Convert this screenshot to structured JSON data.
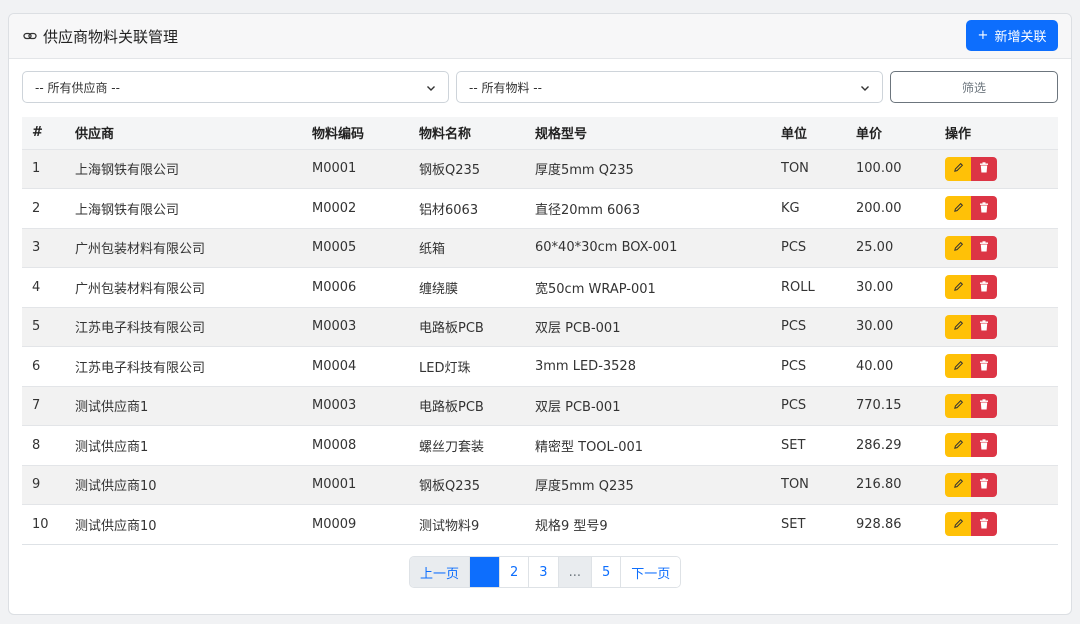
{
  "header": {
    "title": "供应商物料关联管理",
    "add_label": "新增关联"
  },
  "filters": {
    "supplier": "-- 所有供应商 --",
    "material": "-- 所有物料 --",
    "filter_label": "筛选"
  },
  "table": {
    "columns": [
      "#",
      "供应商",
      "物料编码",
      "物料名称",
      "规格型号",
      "单位",
      "单价",
      "操作"
    ],
    "rows": [
      [
        "1",
        "上海钢铁有限公司",
        "M0001",
        "钢板Q235",
        "厚度5mm Q235",
        "TON",
        "100.00"
      ],
      [
        "2",
        "上海钢铁有限公司",
        "M0002",
        "铝材6063",
        "直径20mm 6063",
        "KG",
        "200.00"
      ],
      [
        "3",
        "广州包装材料有限公司",
        "M0005",
        "纸箱",
        "60*40*30cm BOX-001",
        "PCS",
        "25.00"
      ],
      [
        "4",
        "广州包装材料有限公司",
        "M0006",
        "缠绕膜",
        "宽50cm WRAP-001",
        "ROLL",
        "30.00"
      ],
      [
        "5",
        "江苏电子科技有限公司",
        "M0003",
        "电路板PCB",
        "双层 PCB-001",
        "PCS",
        "30.00"
      ],
      [
        "6",
        "江苏电子科技有限公司",
        "M0004",
        "LED灯珠",
        "3mm LED-3528",
        "PCS",
        "40.00"
      ],
      [
        "7",
        "测试供应商1",
        "M0003",
        "电路板PCB",
        "双层 PCB-001",
        "PCS",
        "770.15"
      ],
      [
        "8",
        "测试供应商1",
        "M0008",
        "螺丝刀套装",
        "精密型 TOOL-001",
        "SET",
        "286.29"
      ],
      [
        "9",
        "测试供应商10",
        "M0001",
        "钢板Q235",
        "厚度5mm Q235",
        "TON",
        "216.80"
      ],
      [
        "10",
        "测试供应商10",
        "M0009",
        "测试物料9",
        "规格9 型号9",
        "SET",
        "928.86"
      ]
    ]
  },
  "pagination": {
    "prev": "上一页",
    "current": "",
    "pages": [
      "2",
      "3"
    ],
    "ellipsis": "...",
    "last": "5",
    "next": "下一页"
  },
  "colors": {
    "primary": "#0d6efd",
    "edit": "#ffc107",
    "delete": "#dc3545"
  },
  "icons": {
    "title": "link-icon",
    "add": "plus-icon",
    "edit": "pencil-icon",
    "delete": "trash-icon",
    "dropdown": "chevron-down-icon"
  }
}
